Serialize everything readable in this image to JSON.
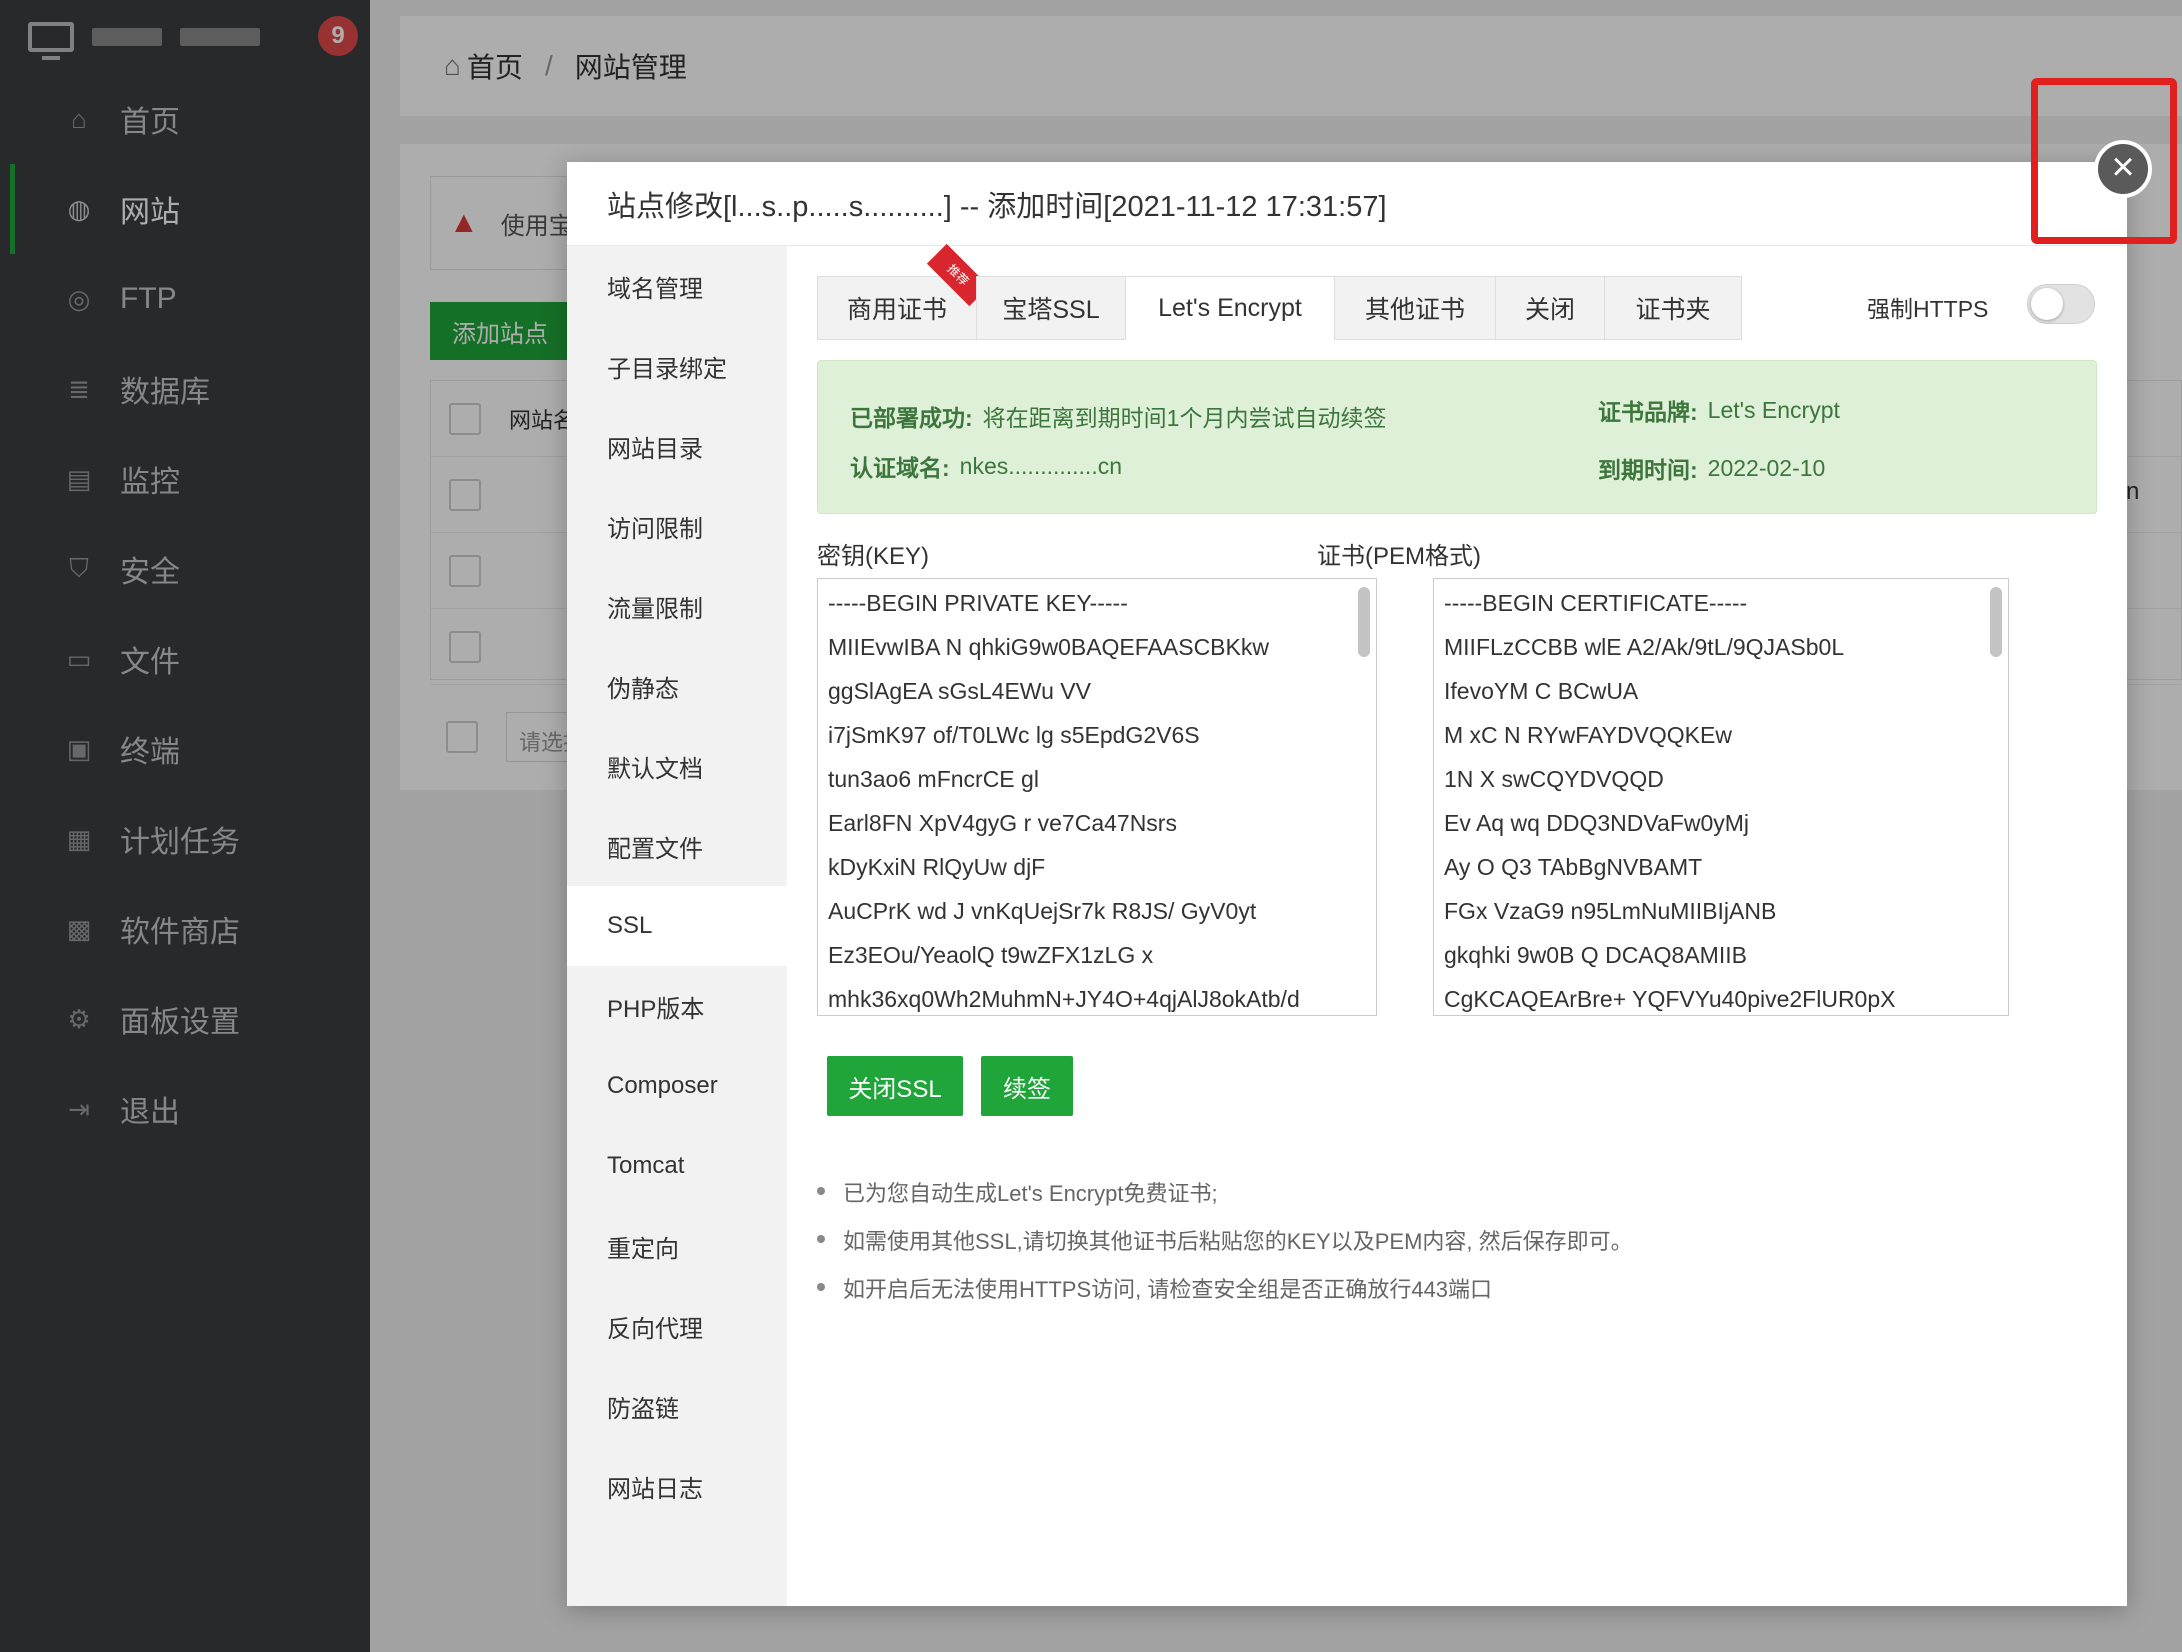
{
  "sidebar": {
    "notification_count": "9",
    "items": [
      {
        "label": "首页",
        "icon": "home-icon",
        "glyph": "⌂"
      },
      {
        "label": "网站",
        "icon": "globe-icon",
        "glyph": "◍"
      },
      {
        "label": "FTP",
        "icon": "ftp-icon",
        "glyph": "◎"
      },
      {
        "label": "数据库",
        "icon": "database-icon",
        "glyph": "≣"
      },
      {
        "label": "监控",
        "icon": "monitor-chart-icon",
        "glyph": "▤"
      },
      {
        "label": "安全",
        "icon": "shield-icon",
        "glyph": "⛉"
      },
      {
        "label": "文件",
        "icon": "folder-icon",
        "glyph": "▭"
      },
      {
        "label": "终端",
        "icon": "terminal-icon",
        "glyph": "▣"
      },
      {
        "label": "计划任务",
        "icon": "calendar-icon",
        "glyph": "▦"
      },
      {
        "label": "软件商店",
        "icon": "apps-icon",
        "glyph": "▩"
      },
      {
        "label": "面板设置",
        "icon": "gear-icon",
        "glyph": "⚙"
      },
      {
        "label": "退出",
        "icon": "logout-icon",
        "glyph": "⇥"
      }
    ]
  },
  "breadcrumb": {
    "home": "首页",
    "separator": "/",
    "current": "网站管理"
  },
  "background": {
    "warning_text": "使用宝",
    "add_site_label": "添加站点",
    "table_header": "网站名",
    "select_placeholder": "请选择",
    "right_fragment": "n"
  },
  "modal": {
    "title": "站点修改[l...s..p.....s..........] -- 添加时间[2021-11-12 17:31:57]",
    "nav": [
      "域名管理",
      "子目录绑定",
      "网站目录",
      "访问限制",
      "流量限制",
      "伪静态",
      "默认文档",
      "配置文件",
      "SSL",
      "PHP版本",
      "Composer",
      "Tomcat",
      "重定向",
      "反向代理",
      "防盗链",
      "网站日志"
    ],
    "active_nav": "SSL",
    "tabs": [
      {
        "label": "商用证书",
        "ribbon": "推荐"
      },
      {
        "label": "宝塔SSL"
      },
      {
        "label": "Let's Encrypt",
        "active": true
      },
      {
        "label": "其他证书"
      },
      {
        "label": "关闭"
      },
      {
        "label": "证书夹"
      }
    ],
    "force_https_label": "强制HTTPS",
    "force_https_on": false,
    "status": {
      "deploy_key": "已部署成功:",
      "deploy_value": "将在距离到期时间1个月内尝试自动续签",
      "domain_key": "认证域名:",
      "domain_value": "nkes..............cn",
      "brand_key": "证书品牌:",
      "brand_value": "Let's Encrypt",
      "expire_key": "到期时间:",
      "expire_value": "2022-02-10"
    },
    "key_label": "密钥(KEY)",
    "cert_label": "证书(PEM格式)",
    "key_lines": [
      "-----BEGIN PRIVATE KEY-----",
      "MIIEvwIBA  N   qhkiG9w0BAQEFAASCBKkw",
      "ggSlAgEA    sGsL4EWu  VV",
      "i7jSmK97    of/T0LWc lg s5EpdG2V6S",
      "tun3ao6    mFncrCE  gl",
      "Earl8FN    XpV4gyG  r ve7Ca47Nsrs",
      "kDyKxiN   RlQyUw  djF",
      "AuCPrK  wd  J  vnKqUejSr7k  R8JS/ GyV0yt",
      "Ez3EOu/YeaolQ t9wZFX1zLG x",
      "mhk36xq0Wh2MuhmN+JY4O+4qjAlJ8okAtb/d"
    ],
    "cert_lines": [
      "-----BEGIN CERTIFICATE-----",
      "MIIFLzCCBB  wlE   A2/Ak/9tL/9QJASb0L",
      "IfevoYM   C    BCwUA",
      "M  xC    N    RYwFAYDVQQKEw",
      "1N  X       swCQYDVQQD",
      "Ev   Aq wq    DDQ3NDVaFw0yMj",
      "Ay   O Q3    TAbBgNVBAMT",
      "FGx  VzaG9    n95LmNuMIIBIjANB",
      "gkqhki 9w0B  Q    DCAQ8AMIIB",
      "CgKCAQEArBre+  YQFVYu40pive2FlUR0pX"
    ],
    "close_ssl_label": "关闭SSL",
    "renew_label": "续签",
    "tips": [
      "已为您自动生成Let's Encrypt免费证书;",
      "如需使用其他SSL,请切换其他证书后粘贴您的KEY以及PEM内容, 然后保存即可。",
      "如开启后无法使用HTTPS访问, 请检查安全组是否正确放行443端口"
    ]
  },
  "colors": {
    "sidebar_bg": "#3a3d3f",
    "accent_green": "#20a53a",
    "success_bg": "#dff0d8",
    "highlight_red": "#e01f1f"
  }
}
